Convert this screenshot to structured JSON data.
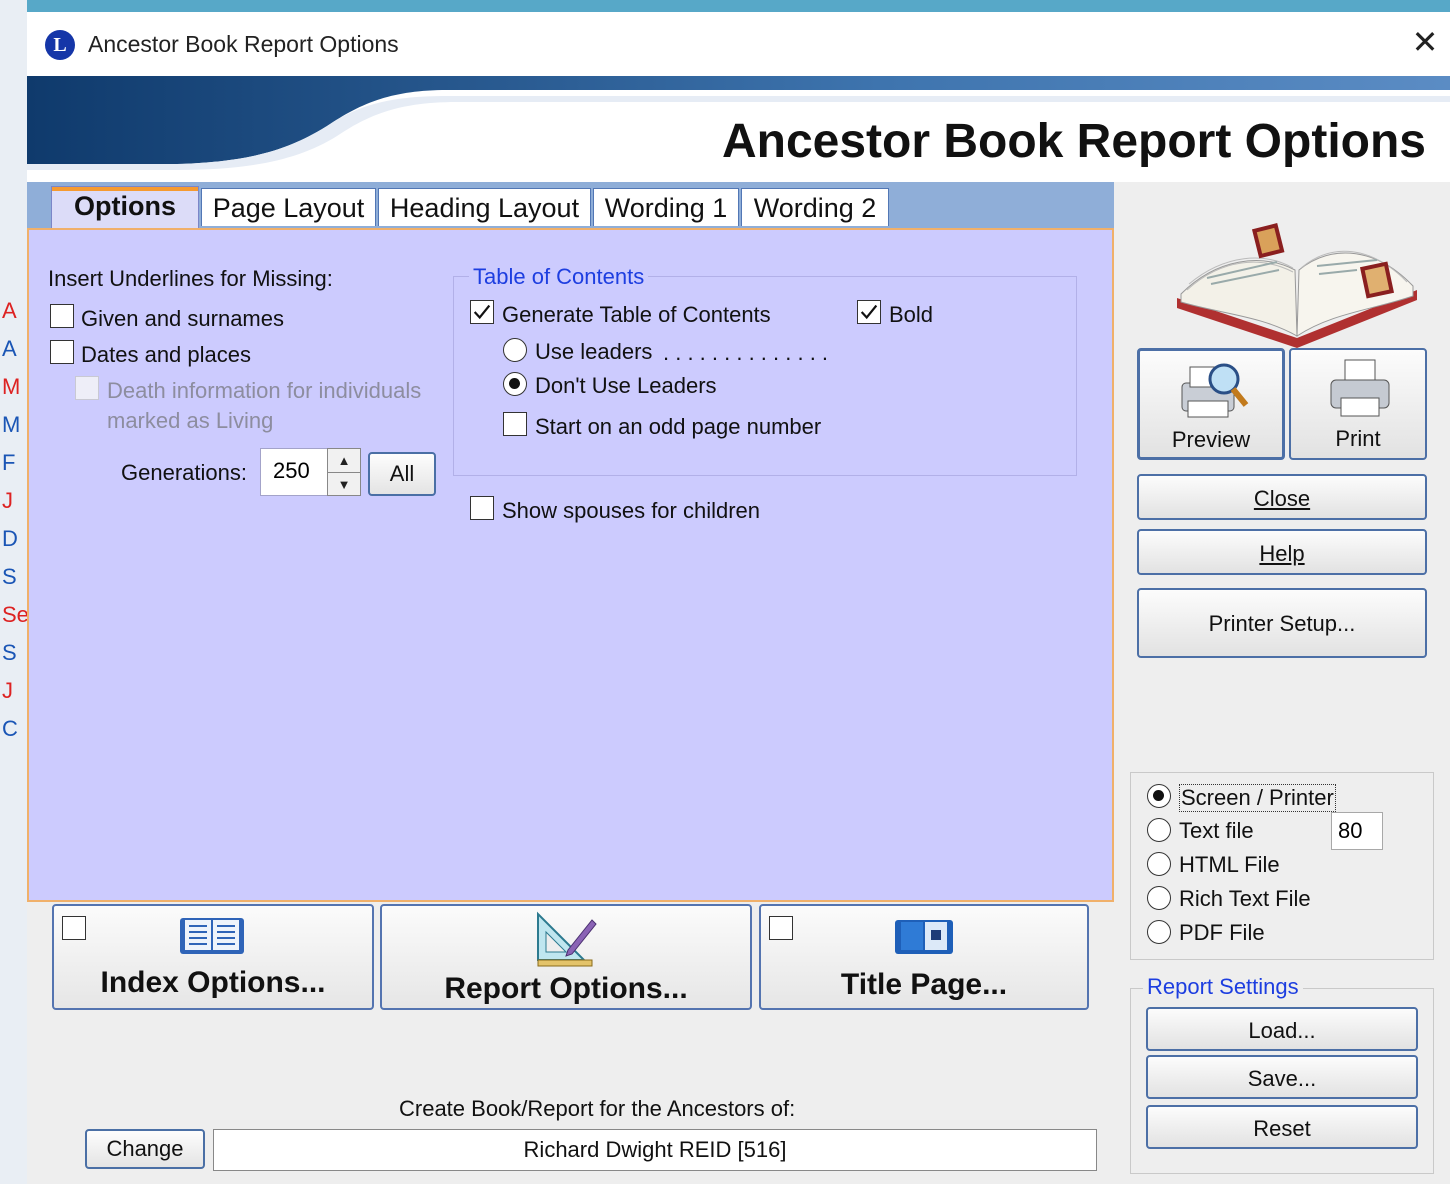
{
  "window": {
    "title": "Ancestor Book Report Options",
    "logo_letter": "L",
    "banner_heading": "Ancestor Book Report Options"
  },
  "tabs": [
    {
      "label": "Options",
      "active": true
    },
    {
      "label": "Page Layout",
      "active": false
    },
    {
      "label": "Heading Layout",
      "active": false
    },
    {
      "label": "Wording 1",
      "active": false
    },
    {
      "label": "Wording 2",
      "active": false
    }
  ],
  "options": {
    "insert_underlines_label": "Insert Underlines for Missing:",
    "given_surnames": {
      "label": "Given and surnames",
      "checked": false
    },
    "dates_places": {
      "label": "Dates and places",
      "checked": false
    },
    "death_info": {
      "label_line1": "Death information for individuals",
      "label_line2": "marked as Living",
      "checked": false,
      "disabled": true
    },
    "generations_label": "Generations:",
    "generations_value": "250",
    "all_button": "All",
    "toc": {
      "legend": "Table of Contents",
      "generate": {
        "label": "Generate Table of Contents",
        "checked": true
      },
      "bold": {
        "label": "Bold",
        "checked": true
      },
      "use_leaders": {
        "label": "Use leaders",
        "leader_dots": ". . . . . . . . . . . . . .",
        "selected": false
      },
      "dont_use_leaders": {
        "label": "Don't Use Leaders",
        "selected": true
      },
      "odd_page": {
        "label": "Start on an odd page number",
        "checked": false
      }
    },
    "show_spouses": {
      "label": "Show spouses for children",
      "checked": false
    }
  },
  "actions": {
    "preview": "Preview",
    "print": "Print",
    "close": "Close",
    "help": "Help",
    "printer_setup": "Printer Setup..."
  },
  "output": {
    "options": [
      {
        "label": "Screen / Printer",
        "selected": true
      },
      {
        "label": "Text file",
        "selected": false
      },
      {
        "label": "HTML File",
        "selected": false
      },
      {
        "label": "Rich Text File",
        "selected": false
      },
      {
        "label": "PDF File",
        "selected": false
      }
    ],
    "text_width": "80"
  },
  "report_settings": {
    "legend": "Report Settings",
    "load": "Load...",
    "save": "Save...",
    "reset": "Reset"
  },
  "bottom": {
    "index_options": {
      "label": "Index Options...",
      "checked": false
    },
    "report_options": {
      "label": "Report Options..."
    },
    "title_page": {
      "label": "Title Page...",
      "checked": false
    },
    "create_for_label": "Create Book/Report for the Ancestors of:",
    "change_button": "Change",
    "person": "Richard Dwight REID [516]"
  },
  "background_app": {
    "letters": [
      "A",
      "A",
      "M",
      "M",
      "F",
      "J",
      "D",
      "S",
      "Se",
      "S",
      "J",
      "C"
    ]
  },
  "colors": {
    "panel": "#cccbfe",
    "tab_strip": "#8faed8",
    "accent_blue": "#1d3ee0",
    "banner_dark": "#1f4f82"
  }
}
